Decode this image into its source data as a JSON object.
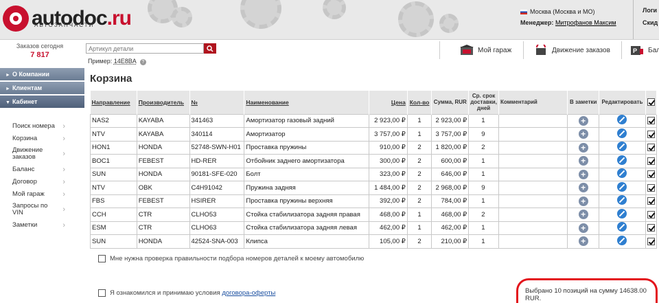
{
  "header": {
    "logo_main": "autodoc",
    "logo_tld": ".ru",
    "logo_sub": "АВТОЗАПЧАСТИ",
    "city": "Москва (Москва и МО)",
    "manager_label": "Менеджер:",
    "manager_name": "Митрофанов Максим",
    "right_top": "Логи",
    "right_bottom": "Скид"
  },
  "orders": {
    "label": "Заказов сегодня",
    "count": "7 817"
  },
  "search": {
    "placeholder": "Артикул детали",
    "example_label": "Пример:",
    "example_value": "14E8BA"
  },
  "topnav": {
    "garage": "Мой гараж",
    "movement": "Движение заказов",
    "balance": "Бал"
  },
  "sidebar": {
    "heads": [
      "О Компании",
      "Клиентам",
      "Кабинет"
    ],
    "items": [
      "Поиск номера",
      "Корзина",
      "Движение заказов",
      "Баланс",
      "Договор",
      "Мой гараж",
      "Запросы по VIN",
      "Заметки"
    ]
  },
  "page_title": "Корзина",
  "table": {
    "headers": {
      "direction": "Направление",
      "maker": "Производитель",
      "num": "№",
      "name": "Наименование",
      "price": "Цена",
      "qty": "Кол-во",
      "sum": "Сумма, RUR",
      "term": "Ср. срок доставки, дней",
      "comment": "Комментарий",
      "notes": "В заметки",
      "edit": "Редактировать"
    },
    "rows": [
      {
        "dir": "NAS2",
        "maker": "KAYABA",
        "num": "341463",
        "name": "Амортизатор газовый задний",
        "price": "2 923,00 ₽",
        "qty": "1",
        "sum": "2 923,00 ₽",
        "term": "1"
      },
      {
        "dir": "NTV",
        "maker": "KAYABA",
        "num": "340114",
        "name": "Амортизатор",
        "price": "3 757,00 ₽",
        "qty": "1",
        "sum": "3 757,00 ₽",
        "term": "9"
      },
      {
        "dir": "HON1",
        "maker": "HONDA",
        "num": "52748-SWN-H01",
        "name": "Проставка пружины",
        "price": "910,00 ₽",
        "qty": "2",
        "sum": "1 820,00 ₽",
        "term": "2"
      },
      {
        "dir": "BOC1",
        "maker": "FEBEST",
        "num": "HD-RER",
        "name": "Отбойник заднего амортизатора",
        "price": "300,00 ₽",
        "qty": "2",
        "sum": "600,00 ₽",
        "term": "1"
      },
      {
        "dir": "SUN",
        "maker": "HONDA",
        "num": "90181-SFE-020",
        "name": "Болт",
        "price": "323,00 ₽",
        "qty": "2",
        "sum": "646,00 ₽",
        "term": "1"
      },
      {
        "dir": "NTV",
        "maker": "OBK",
        "num": "C4H91042",
        "name": "Пружина задняя",
        "price": "1 484,00 ₽",
        "qty": "2",
        "sum": "2 968,00 ₽",
        "term": "9"
      },
      {
        "dir": "FBS",
        "maker": "FEBEST",
        "num": "HSIRER",
        "name": "Проставка пружины верхняя",
        "price": "392,00 ₽",
        "qty": "2",
        "sum": "784,00 ₽",
        "term": "1"
      },
      {
        "dir": "CCH",
        "maker": "CTR",
        "num": "CLHO53",
        "name": "Стойка стабилизатора задняя правая",
        "price": "468,00 ₽",
        "qty": "1",
        "sum": "468,00 ₽",
        "term": "2"
      },
      {
        "dir": "ESM",
        "maker": "CTR",
        "num": "CLHO63",
        "name": "Стойка стабилизатора задняя левая",
        "price": "462,00 ₽",
        "qty": "1",
        "sum": "462,00 ₽",
        "term": "1"
      },
      {
        "dir": "SUN",
        "maker": "HONDA",
        "num": "42524-SNA-003",
        "name": "Клипса",
        "price": "105,00 ₽",
        "qty": "2",
        "sum": "210,00 ₽",
        "term": "1"
      }
    ]
  },
  "options": {
    "check_text": "Мне нужна проверка правильности подбора номеров деталей к моему автомобилю",
    "agree_text": "Я ознакомился и принимаю условия",
    "agree_link": "договора-оферты"
  },
  "summary": "Выбрано 10 позиций на сумму 14638.00 RUR."
}
